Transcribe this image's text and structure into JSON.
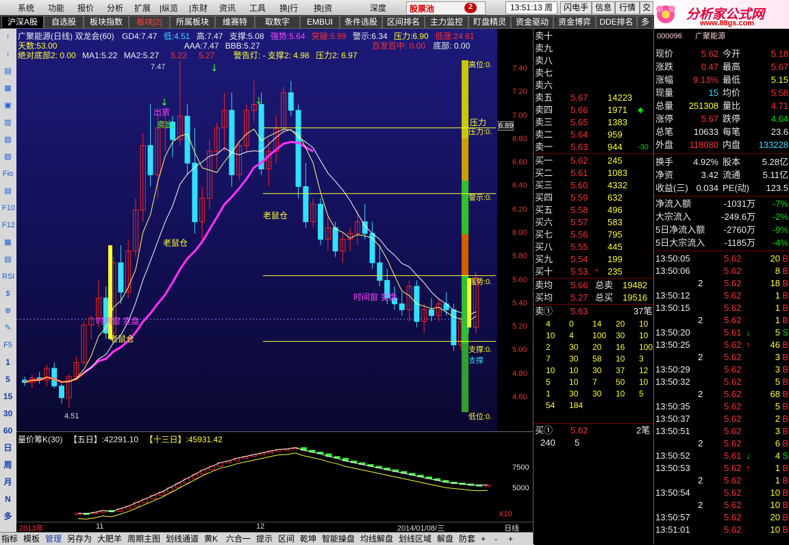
{
  "menu": {
    "items": [
      "系统",
      "功能",
      "报价",
      "分析",
      "扩展",
      "|纵览",
      "|东财",
      "资讯",
      "工具",
      "换|行",
      "换|资",
      "深度"
    ],
    "stock_pool": "股票池",
    "stock_pool_badge": "2",
    "time": "13:51:13",
    "weekday": "周五",
    "right_buttons": [
      "闪电手",
      "信息",
      "行情",
      "交"
    ]
  },
  "logo": {
    "title": "分析家公式网",
    "url": "www.88gs.com"
  },
  "tabs": [
    "沪深A股",
    "自选股",
    "板块指数",
    "板块[2]",
    "所属板块",
    "维赛特",
    "取数字",
    "EMBUI",
    "条件选股",
    "区间排名",
    "主力监控",
    "盯盘精灵",
    "资金驱动",
    "资金博弈",
    "DDE排名",
    "多"
  ],
  "left_toolbar": [
    "↑",
    "↓",
    "▤",
    "▦",
    "▣",
    "▥",
    "▨",
    "▧",
    "Fio",
    "▤",
    "F10",
    "F12",
    "▦",
    "▤",
    "RSI",
    "$",
    "⊕",
    "✎",
    "F5",
    "1",
    "5",
    "15",
    "30",
    "60",
    "日",
    "周",
    "月",
    "N",
    "多"
  ],
  "chart": {
    "stock_line": "广聚能源(日线) 双龙会(60)",
    "gd4_label": "GD4:",
    "gd4": "7.47",
    "low_label": "低:",
    "low": "4.51",
    "high_label": "高:",
    "high": "7.47",
    "support_label": "支撑:",
    "support": "5.08",
    "strong_label": "强势:",
    "strong": "5.64",
    "break_label": "突破:",
    "break": "5.99",
    "warn_label": "警示:",
    "warn": "6.34",
    "pressure_label": "压力:",
    "pressure": "6.90",
    "lowrise_label": "低涨:",
    "lowrise": "24.61",
    "days_label": "天数:",
    "days": "53.00",
    "aaa_label": "AAA:",
    "aaa": "7.47",
    "bbb_label": "BBB:",
    "bbb": "5.27",
    "baifa": "百发百中: 0.00",
    "bottom0": "底部: 0.00",
    "jdbottom": "绝对底部2: 0.00",
    "ma1_label": "MA1:",
    "ma1": "5.22",
    "ma2_label": "MA2:",
    "ma2": "5.27",
    "ma3": "5.22",
    "ma4": "5.27",
    "alert": "警告灯: - 支撑2: 4.98",
    "pressure2": "压力2: 6.97",
    "labels": {
      "sell_out": "出货",
      "sell": "卖出",
      "old_mouse": "老鼠仓",
      "old_mouse2": "老鼠仓",
      "old_mouse3": "老鼠仓",
      "timewindow": "时间窗 变盘",
      "timewindow2": "时间窗 变盘",
      "high_mark": "7.47",
      "low_mark": "4.51",
      "pressure_tag": "压力",
      "pressure_tag2": "压力:0.",
      "warn_tag": "警示:0.",
      "strong_tag": "强势:0.",
      "support_tag": "支撑:0.",
      "support_tag2": "支撑",
      "low_tag": "低位:0.",
      "high_tag": "高位:0.",
      "price_tag": "6.89"
    },
    "axis": [
      "7.40",
      "7.20",
      "7.00",
      "6.80",
      "6.60",
      "6.40",
      "6.20",
      "6.00",
      "5.80",
      "5.60",
      "5.40",
      "5.20",
      "5.00",
      "4.80",
      "4.60"
    ]
  },
  "volume": {
    "title": "量价筹K(30)",
    "five_label": "【五日】:",
    "five": "42291.10",
    "thirteen_label": "【十三日】:",
    "thirteen": "45931.42",
    "axis": [
      "7500",
      "5000"
    ],
    "x10": "X10"
  },
  "dates": {
    "a": "2013年",
    "b": "11",
    "c": "12",
    "d": "2014/01/08/三",
    "e": "日线"
  },
  "bottom_tabs": [
    "指标",
    "模板",
    "管理",
    "另存为",
    "大肥羊",
    "周期主图",
    "划线通道",
    "黄K",
    "六合一",
    "提示",
    "区间",
    "乾坤",
    "智能操盘",
    "均线解盘",
    "划线区域",
    "解盘",
    "防套",
    "+",
    "-",
    "+"
  ],
  "book": {
    "asks_empty": [
      "卖十",
      "卖九",
      "卖八",
      "卖七",
      "卖六"
    ],
    "asks": [
      {
        "label": "卖五",
        "price": "5.67",
        "vol": "14223",
        "mark": ""
      },
      {
        "label": "卖四",
        "price": "5.66",
        "vol": "1971",
        "mark": "◆"
      },
      {
        "label": "卖三",
        "price": "5.65",
        "vol": "1383",
        "mark": ""
      },
      {
        "label": "卖二",
        "price": "5.64",
        "vol": "959",
        "mark": ""
      },
      {
        "label": "卖一",
        "price": "5.63",
        "vol": "944",
        "mark": "-30"
      }
    ],
    "bids": [
      {
        "label": "买一",
        "price": "5.62",
        "vol": "245",
        "mark": ""
      },
      {
        "label": "买二",
        "price": "5.61",
        "vol": "1083",
        "mark": ""
      },
      {
        "label": "买三",
        "price": "5.60",
        "vol": "4332",
        "mark": ""
      },
      {
        "label": "买四",
        "price": "5.59",
        "vol": "632",
        "mark": ""
      },
      {
        "label": "买五",
        "price": "5.58",
        "vol": "496",
        "mark": ""
      },
      {
        "label": "买六",
        "price": "5.57",
        "vol": "583",
        "mark": ""
      },
      {
        "label": "买七",
        "price": "5.56",
        "vol": "795",
        "mark": ""
      },
      {
        "label": "买八",
        "price": "5.55",
        "vol": "445",
        "mark": ""
      },
      {
        "label": "买九",
        "price": "5.54",
        "vol": "199",
        "mark": ""
      },
      {
        "label": "买十",
        "price": "5.53",
        "vol": "235",
        "mark": "*"
      }
    ],
    "ask_avg_label": "卖均",
    "ask_avg": "5.66",
    "total_sell_label": "总卖",
    "total_sell": "19482",
    "bid_avg_label": "买均",
    "bid_avg": "5.27",
    "total_buy_label": "总买",
    "total_buy": "19516",
    "sell1_label": "卖①",
    "sell1_price": "5.63",
    "sell1_count": "37笔",
    "queue": [
      [
        "4",
        "0",
        "14",
        "20",
        "10"
      ],
      [
        "10",
        "4",
        "100",
        "30",
        "10"
      ],
      [
        "2",
        "30",
        "20",
        "16",
        "100"
      ],
      [
        "7",
        "30",
        "58",
        "10",
        "3"
      ],
      [
        "10",
        "10",
        "30",
        "37",
        "12"
      ],
      [
        "5",
        "10",
        "7",
        "50",
        "10"
      ],
      [
        "1",
        "30",
        "30",
        "10",
        "5"
      ],
      [
        "54",
        "184",
        "",
        "",
        ""
      ]
    ],
    "buy1_label": "买①",
    "buy1_price": "5.62",
    "buy1_count": "2笔",
    "buy_queue": [
      "240",
      "5"
    ]
  },
  "stats": {
    "title": "广聚能源",
    "code": "000096",
    "rows": [
      {
        "l1": "现价",
        "v1": "5.62",
        "c1": "red",
        "l2": "今开",
        "v2": "5.18",
        "c2": "red"
      },
      {
        "l1": "涨跌",
        "v1": "0.47",
        "c1": "red",
        "l2": "最高",
        "v2": "5.67",
        "c2": "red"
      },
      {
        "l1": "涨幅",
        "v1": "9.13%",
        "c1": "red",
        "l2": "最低",
        "v2": "5.15",
        "c2": "yel"
      },
      {
        "l1": "现量",
        "v1": "15",
        "c1": "cyn",
        "l2": "均价",
        "v2": "5.58",
        "c2": "red"
      },
      {
        "l1": "总量",
        "v1": "251308",
        "c1": "yel",
        "l2": "量比",
        "v2": "4.71",
        "c2": "red"
      },
      {
        "l1": "涨停",
        "v1": "5.67",
        "c1": "red",
        "l2": "跌停",
        "v2": "4.64",
        "c2": "grn"
      },
      {
        "l1": "总笔",
        "v1": "10633",
        "c1": "wht",
        "l2": "每笔",
        "v2": "23.6",
        "c2": "wht"
      },
      {
        "l1": "外盘",
        "v1": "118080",
        "c1": "red",
        "l2": "内盘",
        "v2": "133228",
        "c2": "cyn"
      }
    ],
    "rows2": [
      {
        "l1": "换手",
        "v1": "4.92%",
        "l2": "股本",
        "v2": "5.28亿"
      },
      {
        "l1": "净资",
        "v1": "3.42",
        "l2": "流通",
        "v2": "5.11亿"
      },
      {
        "l1": "收益(三)",
        "v1": "0.034",
        "l2": "PE(动)",
        "v2": "123.5"
      }
    ],
    "flows": [
      {
        "l": "净流入额",
        "v": "-1031万",
        "p": "-7%"
      },
      {
        "l": "大宗流入",
        "v": "-249.6万",
        "p": "-2%"
      },
      {
        "l": "5日净流入额",
        "v": "-2760万",
        "p": "-9%"
      },
      {
        "l": "5日大宗流入",
        "v": "-1185万",
        "p": "-4%"
      }
    ],
    "ticks": [
      {
        "t": "13:50:05",
        "p": "5.62",
        "v": "20",
        "s": "B",
        "ind": "",
        "pc": "red"
      },
      {
        "t": "13:50:06",
        "p": "5.62",
        "v": "8",
        "s": "B",
        "ind": "",
        "pc": "red"
      },
      {
        "t": "",
        "n": "2",
        "p": "5.62",
        "v": "18",
        "s": "B",
        "ind": "",
        "pc": "red"
      },
      {
        "t": "13:50:12",
        "p": "5.62",
        "v": "1",
        "s": "B",
        "ind": "",
        "pc": "red"
      },
      {
        "t": "13:50:15",
        "p": "5.62",
        "v": "1",
        "s": "B",
        "ind": "",
        "pc": "red"
      },
      {
        "t": "",
        "n": "2",
        "p": "5.62",
        "v": "1",
        "s": "B",
        "ind": "",
        "pc": "red"
      },
      {
        "t": "13:50:20",
        "p": "5.61",
        "v": "5",
        "s": "S",
        "ind": "↓",
        "pc": "red"
      },
      {
        "t": "13:50:25",
        "p": "5.62",
        "v": "46",
        "s": "B",
        "ind": "↑",
        "pc": "red"
      },
      {
        "t": "",
        "n": "2",
        "p": "5.62",
        "v": "3",
        "s": "B",
        "ind": "",
        "pc": "red"
      },
      {
        "t": "13:50:29",
        "p": "5.62",
        "v": "3",
        "s": "B",
        "ind": "",
        "pc": "red"
      },
      {
        "t": "13:50:32",
        "p": "5.62",
        "v": "5",
        "s": "B",
        "ind": "",
        "pc": "red"
      },
      {
        "t": "",
        "n": "2",
        "p": "5.62",
        "v": "68",
        "s": "B",
        "ind": "",
        "pc": "red"
      },
      {
        "t": "13:50:35",
        "p": "5.62",
        "v": "5",
        "s": "B",
        "ind": "",
        "pc": "red"
      },
      {
        "t": "13:50:37",
        "p": "5.62",
        "v": "2",
        "s": "B",
        "ind": "",
        "pc": "red"
      },
      {
        "t": "13:50:51",
        "p": "5.62",
        "v": "3",
        "s": "B",
        "ind": "",
        "pc": "red"
      },
      {
        "t": "",
        "n": "2",
        "p": "5.62",
        "v": "6",
        "s": "B",
        "ind": "",
        "pc": "red"
      },
      {
        "t": "13:50:52",
        "p": "5.61",
        "v": "4",
        "s": "S",
        "ind": "↓",
        "pc": "red"
      },
      {
        "t": "13:50:53",
        "p": "5.62",
        "v": "1",
        "s": "B",
        "ind": "↑",
        "pc": "red"
      },
      {
        "t": "",
        "n": "2",
        "p": "5.62",
        "v": "1",
        "s": "B",
        "ind": "",
        "pc": "red"
      },
      {
        "t": "13:50:54",
        "p": "5.62",
        "v": "10",
        "s": "B",
        "ind": "",
        "pc": "red"
      },
      {
        "t": "",
        "n": "2",
        "p": "5.62",
        "v": "10",
        "s": "B",
        "ind": "",
        "pc": "red"
      },
      {
        "t": "13:50:57",
        "p": "5.62",
        "v": "20",
        "s": "B",
        "ind": "",
        "pc": "red"
      },
      {
        "t": "13:51:01",
        "p": "5.62",
        "v": "10",
        "s": "B",
        "ind": "",
        "pc": "red"
      },
      {
        "t": "13:51:02",
        "p": "5.62",
        "v": "15",
        "s": "B",
        "ind": "",
        "pc": "red"
      }
    ]
  },
  "colors": {
    "up": "#ff2020",
    "down": "#30e0ff",
    "bg": "#1d1a7a",
    "ma_red": "#ff1010",
    "ma_mag": "#ff30ff",
    "yellow": "#ffff30"
  },
  "chart_data": {
    "type": "candlestick",
    "title": "广聚能源(日线) 双龙会(60)",
    "y_range": [
      4.5,
      7.5
    ],
    "candles": [
      [
        4.75,
        4.78,
        4.7,
        4.73
      ],
      [
        4.73,
        4.8,
        4.68,
        4.77
      ],
      [
        4.77,
        4.82,
        4.72,
        4.75
      ],
      [
        4.75,
        4.88,
        4.7,
        4.85
      ],
      [
        4.85,
        4.9,
        4.68,
        4.7
      ],
      [
        4.7,
        4.72,
        4.55,
        4.6
      ],
      [
        4.6,
        4.8,
        4.51,
        4.78
      ],
      [
        4.78,
        4.95,
        4.75,
        4.9
      ],
      [
        4.9,
        5.25,
        4.88,
        5.22
      ],
      [
        5.22,
        5.3,
        5.1,
        5.28
      ],
      [
        5.28,
        5.6,
        5.2,
        5.45
      ],
      [
        5.45,
        5.55,
        5.1,
        5.15
      ],
      [
        5.15,
        5.8,
        5.1,
        5.75
      ],
      [
        5.75,
        5.9,
        5.4,
        5.5
      ],
      [
        5.5,
        5.95,
        5.45,
        5.85
      ],
      [
        5.85,
        6.3,
        5.8,
        6.2
      ],
      [
        6.2,
        6.85,
        6.1,
        6.75
      ],
      [
        6.75,
        7.1,
        6.4,
        6.5
      ],
      [
        6.5,
        7.0,
        6.3,
        6.9
      ],
      [
        6.9,
        7.05,
        6.7,
        6.95
      ],
      [
        6.95,
        7.0,
        6.65,
        6.8
      ],
      [
        6.8,
        7.47,
        6.75,
        7.0
      ],
      [
        7.0,
        7.1,
        6.5,
        6.6
      ],
      [
        6.6,
        6.9,
        6.0,
        6.1
      ],
      [
        6.1,
        6.4,
        5.95,
        6.3
      ],
      [
        6.3,
        6.8,
        6.2,
        6.7
      ],
      [
        6.7,
        6.95,
        6.55,
        6.9
      ],
      [
        6.9,
        7.2,
        6.7,
        7.05
      ],
      [
        7.05,
        7.2,
        6.4,
        6.5
      ],
      [
        6.5,
        6.8,
        6.45,
        6.75
      ],
      [
        6.75,
        7.1,
        6.7,
        7.05
      ],
      [
        7.05,
        7.3,
        6.95,
        7.1
      ],
      [
        7.1,
        7.2,
        6.5,
        6.55
      ],
      [
        6.55,
        6.8,
        6.4,
        6.7
      ],
      [
        6.7,
        7.0,
        6.6,
        6.9
      ],
      [
        6.9,
        7.25,
        6.85,
        7.2
      ],
      [
        7.2,
        7.3,
        7.0,
        7.05
      ],
      [
        7.05,
        7.1,
        6.3,
        6.4
      ],
      [
        6.4,
        6.6,
        6.05,
        6.1
      ],
      [
        6.1,
        6.3,
        6.05,
        6.25
      ],
      [
        6.25,
        6.3,
        5.9,
        5.95
      ],
      [
        5.95,
        6.15,
        5.85,
        6.05
      ],
      [
        6.05,
        6.1,
        5.8,
        5.85
      ],
      [
        5.85,
        6.0,
        5.75,
        5.95
      ],
      [
        5.95,
        6.05,
        5.85,
        6.0
      ],
      [
        6.0,
        6.2,
        5.9,
        6.1
      ],
      [
        6.1,
        6.25,
        5.95,
        6.0
      ],
      [
        6.0,
        6.1,
        5.7,
        5.75
      ],
      [
        5.75,
        5.9,
        5.55,
        5.6
      ],
      [
        5.6,
        5.7,
        5.4,
        5.45
      ],
      [
        5.45,
        5.55,
        5.35,
        5.4
      ],
      [
        5.4,
        5.5,
        5.3,
        5.35
      ],
      [
        5.35,
        5.6,
        5.25,
        5.55
      ],
      [
        5.55,
        5.6,
        5.2,
        5.25
      ],
      [
        5.25,
        5.4,
        5.15,
        5.35
      ],
      [
        5.35,
        5.45,
        5.25,
        5.3
      ],
      [
        5.3,
        5.45,
        5.25,
        5.4
      ],
      [
        5.4,
        5.5,
        5.3,
        5.35
      ],
      [
        5.35,
        5.4,
        5.0,
        5.05
      ],
      [
        5.05,
        5.3,
        5.0,
        5.25
      ],
      [
        5.25,
        5.35,
        5.15,
        5.2
      ],
      [
        5.2,
        5.67,
        5.15,
        5.62
      ]
    ],
    "volume_k": [
      [
        1400,
        1500
      ],
      [
        1500,
        1450
      ],
      [
        1450,
        1600
      ],
      [
        1600,
        1800
      ],
      [
        1800,
        1700
      ],
      [
        1700,
        2000
      ],
      [
        2000,
        2300
      ],
      [
        2300,
        2700
      ],
      [
        2700,
        3100
      ],
      [
        3100,
        3500
      ],
      [
        3500,
        3900
      ],
      [
        3900,
        4400
      ],
      [
        4400,
        4900
      ],
      [
        4900,
        5400
      ],
      [
        5400,
        5900
      ],
      [
        5900,
        6400
      ],
      [
        6400,
        6800
      ],
      [
        6800,
        7200
      ],
      [
        7200,
        7400
      ],
      [
        7400,
        7700
      ],
      [
        7700,
        7900
      ],
      [
        7900,
        8100
      ],
      [
        8100,
        8300
      ],
      [
        8300,
        8500
      ],
      [
        8500,
        8700
      ],
      [
        8700,
        8750
      ],
      [
        8750,
        8900
      ],
      [
        8900,
        8600
      ],
      [
        8600,
        8400
      ],
      [
        8400,
        8200
      ],
      [
        8200,
        7900
      ],
      [
        7900,
        7700
      ],
      [
        7700,
        7400
      ],
      [
        7400,
        7200
      ],
      [
        7200,
        7000
      ],
      [
        7000,
        6800
      ],
      [
        6800,
        6600
      ],
      [
        6600,
        6400
      ],
      [
        6400,
        6200
      ],
      [
        6200,
        6000
      ],
      [
        6000,
        5800
      ],
      [
        5800,
        5600
      ],
      [
        5600,
        5400
      ],
      [
        5400,
        5200
      ],
      [
        5200,
        5000
      ],
      [
        5000,
        4900
      ],
      [
        4900,
        4800
      ],
      [
        4800,
        4700
      ],
      [
        4700,
        4650
      ],
      [
        4650,
        4700
      ]
    ]
  }
}
